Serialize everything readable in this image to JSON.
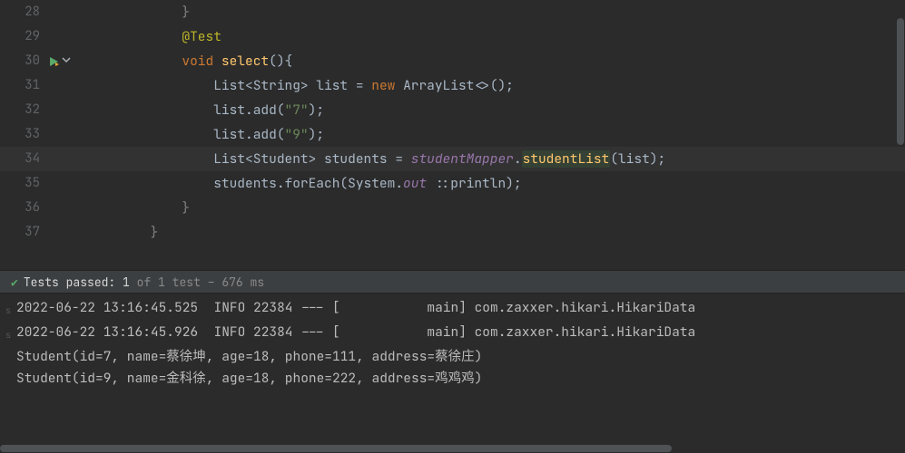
{
  "gutter": {
    "l28": "28",
    "l29": "29",
    "l30": "30",
    "l31": "31",
    "l32": "32",
    "l33": "33",
    "l34": "34",
    "l35": "35",
    "l36": "36",
    "l37": "37"
  },
  "code": {
    "l28_brace": "}",
    "ann": "@Test",
    "kw_void": "void",
    "m_select": "select",
    "sig_paren": "(){",
    "List": "List",
    "lt": "<",
    "gt": ">",
    "String": "String",
    "sp": " ",
    "var_list": "list",
    "eq": " = ",
    "kw_new": "new",
    "ArrayList": "ArrayList",
    "diamond": "<>",
    "paren_close_semi": "();",
    "add": ".add(",
    "str7": "\"7\"",
    "str9": "\"9\"",
    "close_add": ");",
    "Student": "Student",
    "var_students": "students",
    "studentMapper": "studentMapper",
    "dot": ".",
    "studentList": "studentList",
    "open_p": "(",
    "close_p_semi": ");",
    "forEach": ".forEach(",
    "System": "System",
    "out": "out",
    "ref": " ::",
    "println": "println",
    "close_fe": ");",
    "brace_close1": "}",
    "brace_close2": "}"
  },
  "tests": {
    "label_passed": "Tests passed:",
    "count": "1",
    "of": "of 1 test",
    "sep": "–",
    "time": "676 ms"
  },
  "console": {
    "l1": "2022-06-22 13:16:45.525  INFO 22384 --- [           main] com.zaxxer.hikari.HikariData",
    "l2": "2022-06-22 13:16:45.926  INFO 22384 --- [           main] com.zaxxer.hikari.HikariData",
    "l3": "Student(id=7, name=蔡徐坤, age=18, phone=111, address=蔡徐庄)",
    "l4": "Student(id=9, name=金科徐, age=18, phone=222, address=鸡鸡鸡)"
  }
}
